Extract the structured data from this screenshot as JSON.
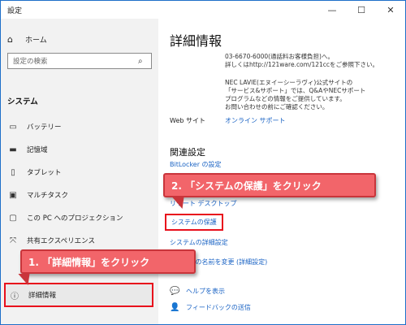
{
  "window": {
    "title": "設定",
    "minimize": "—",
    "maximize": "☐",
    "close": "✕"
  },
  "sidebar": {
    "home": "ホーム",
    "search_placeholder": "設定の検索",
    "section": "システム",
    "items": [
      {
        "label": "バッテリー",
        "icon": "battery-icon"
      },
      {
        "label": "記憶域",
        "icon": "storage-icon"
      },
      {
        "label": "タブレット",
        "icon": "tablet-icon"
      },
      {
        "label": "マルチタスク",
        "icon": "multitask-icon"
      },
      {
        "label": "この PC へのプロジェクション",
        "icon": "projection-icon"
      },
      {
        "label": "共有エクスペリエンス",
        "icon": "shared-experience-icon"
      },
      {
        "label": "詳細情報",
        "icon": "info-icon"
      }
    ]
  },
  "content": {
    "title": "詳細情報",
    "support_phone": "03-6670-6000(通話料お客様負担)へ。",
    "support_details": "詳しくはhttp://121ware.com/121ccをご参照下さい。",
    "support_para": "NEC LAVIE(エヌイーシーラヴィ)公式サイトの\n「サービス&サポート」では、Q&AやNECサポート\nプログラムなどの情報をご提供しています。\nお問い合わせの前にご確認ください。",
    "website_label": "Web サイト",
    "website_link": "オンライン サポート",
    "related_title": "関連設定",
    "bitlocker": "BitLocker の設定",
    "remote_partial": "リモート デスクトップ",
    "system_protection": "システムの保護",
    "advanced_system": "システムの詳細設定",
    "rename_partial": "この PC の名前を変更 (詳細設定)",
    "help": "ヘルプを表示",
    "feedback": "フィードバックの送信"
  },
  "callouts": {
    "step1": "1. 「詳細情報」をクリック",
    "step2": "2. 「システムの保護」をクリック"
  },
  "colors": {
    "accent_red": "#e8101c",
    "callout_fill": "#f2656a",
    "link_blue": "#1a63c4"
  }
}
